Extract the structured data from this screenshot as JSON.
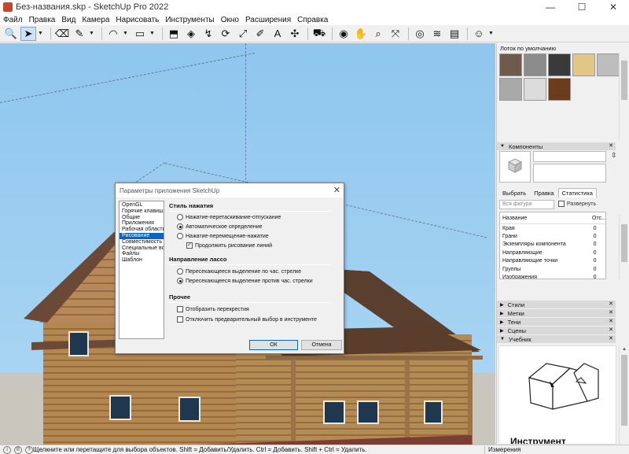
{
  "window": {
    "title": "Без-названия.skp - SketchUp Pro 2022",
    "controls": {
      "minimize": "—",
      "maximize": "☐",
      "close": "✕"
    }
  },
  "menu": [
    "Файл",
    "Правка",
    "Вид",
    "Камера",
    "Нарисовать",
    "Инструменты",
    "Окно",
    "Расширения",
    "Справка"
  ],
  "toolbar": {
    "tools": [
      {
        "name": "zoom-icon",
        "glyph": "🔍"
      },
      {
        "name": "select-icon",
        "glyph": "➤"
      },
      {
        "name": "eraser-icon",
        "glyph": "⌫"
      },
      {
        "name": "pencil-icon",
        "glyph": "✎"
      },
      {
        "name": "arc-icon",
        "glyph": "◠"
      },
      {
        "name": "shape-icon",
        "glyph": "▭"
      },
      {
        "name": "push-pull-icon",
        "glyph": "⬒"
      },
      {
        "name": "offset-icon",
        "glyph": "◈"
      },
      {
        "name": "follow-me-icon",
        "glyph": "↯"
      },
      {
        "name": "rotate-icon",
        "glyph": "⟳"
      },
      {
        "name": "scale-icon",
        "glyph": "⤢"
      },
      {
        "name": "tape-measure-icon",
        "glyph": "✐"
      },
      {
        "name": "text-icon",
        "glyph": "A"
      },
      {
        "name": "axes-icon",
        "glyph": "✣"
      },
      {
        "name": "paint-bucket-icon",
        "glyph": "⛟"
      },
      {
        "name": "orbit-icon",
        "glyph": "◉"
      },
      {
        "name": "pan-icon",
        "glyph": "✋"
      },
      {
        "name": "zoom-tool-icon",
        "glyph": "⌕"
      },
      {
        "name": "zoom-extents-icon",
        "glyph": "⤧"
      },
      {
        "name": "warehouse-icon",
        "glyph": "◎"
      },
      {
        "name": "extension-warehouse-icon",
        "glyph": "≋"
      },
      {
        "name": "layout-icon",
        "glyph": "▤"
      },
      {
        "name": "account-icon",
        "glyph": "☺"
      }
    ]
  },
  "dialog": {
    "title": "Параметры приложения SketchUp",
    "close": "✕",
    "categories": [
      "OpenGL",
      "Горячие клавиши",
      "Общие",
      "Приложения",
      "Рабочая область",
      "Рисование",
      "Совместимость",
      "Специальные возможности",
      "Файлы",
      "Шаблон"
    ],
    "selected_category": "Рисование",
    "click_style": {
      "heading": "Стиль нажатия",
      "options": [
        "Нажатие-перетаскивание-отпускание",
        "Автоматическое определение",
        "Нажатие-перемещение-нажатие"
      ],
      "selected": 1,
      "continue_lines": "Продолжить рисование линий"
    },
    "lasso": {
      "heading": "Направление лассо",
      "options": [
        "Пересекающееся выделение по час. стрелке",
        "Пересекающееся выделение против час. стрелки"
      ],
      "selected": 1
    },
    "misc": {
      "heading": "Прочее",
      "crosshairs": "Отобразить перекрестия",
      "disable_preselect": "Отключить предварительный выбор в инструменте"
    },
    "ok": "ОК",
    "cancel": "Отмена"
  },
  "tray": {
    "default_tray": "Лоток по умолчанию",
    "materials": [
      "#6f5a4d",
      "#8c8c8c",
      "#3a3a3a",
      "#e3c585",
      "#bdbdbd",
      "#a9a9a9",
      "#dcdcdc",
      "#6b3c1e"
    ],
    "components": {
      "title": "Компоненты",
      "tabs": [
        "Выбрать",
        "Правка",
        "Статистика"
      ],
      "active_tab": "Статистика",
      "filter_placeholder": "Вся фигура",
      "expand_label": "Развернуть",
      "columns": [
        "Название",
        "Отс..."
      ],
      "rows": [
        {
          "name": "Края",
          "count": "0"
        },
        {
          "name": "Грани",
          "count": "0"
        },
        {
          "name": "Экземпляры компонента",
          "count": "0"
        },
        {
          "name": "Направляющие",
          "count": "0"
        },
        {
          "name": "Направляющие точки",
          "count": "0"
        },
        {
          "name": "Группы",
          "count": "0"
        },
        {
          "name": "Изображения",
          "count": "0"
        }
      ]
    },
    "panels": [
      "Стили",
      "Метки",
      "Тени",
      "Сцены"
    ],
    "tutorial": {
      "title": "Учебник",
      "heading": "Инструмент"
    }
  },
  "status": {
    "hint": "Щелкните или перетащите для выбора объектов. Shift = Добавить/Удалить. Ctrl = Добавить. Shift + Ctrl = Удалить.",
    "measure_label": "Измерения"
  }
}
